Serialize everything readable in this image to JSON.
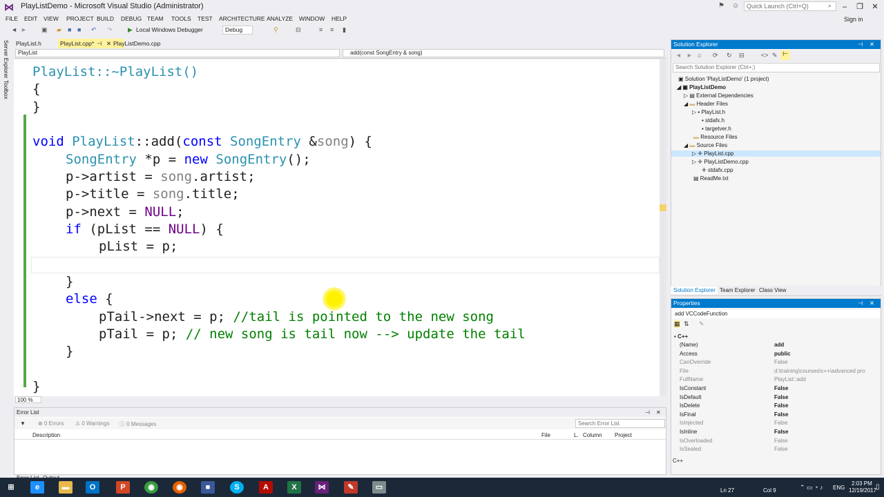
{
  "window": {
    "title": "PlayListDemo - Microsoft Visual Studio (Administrator)",
    "quick_launch_placeholder": "Quick Launch (Ctrl+Q)",
    "signin": "Sign in"
  },
  "menu": [
    "FILE",
    "EDIT",
    "VIEW",
    "PROJECT",
    "BUILD",
    "DEBUG",
    "TEAM",
    "TOOLS",
    "TEST",
    "ARCHITECTURE",
    "ANALYZE",
    "WINDOW",
    "HELP"
  ],
  "toolbar": {
    "debugger": "Local Windows Debugger",
    "configuration": "Debug"
  },
  "side_strip": [
    "Server Explorer",
    "Toolbox"
  ],
  "doc_tabs": [
    "PlayList.h",
    "PlayList.cpp*",
    "PlayListDemo.cpp"
  ],
  "navbar": {
    "scope": "PlayList",
    "member": "add(const SongEntry & song)"
  },
  "code": {
    "l1": "PlayList::~PlayList()",
    "l2": "{",
    "l3": "}",
    "l5_kw": "void",
    "l5_cls": "PlayList",
    "l5_a": "::add(",
    "l5_const": "const",
    "l5_type": "SongEntry",
    "l5_b": " &",
    "l5_param": "song",
    "l5_c": ") {",
    "l6_type": "SongEntry",
    "l6_a": " *p = ",
    "l6_new": "new",
    "l6_type2": "SongEntry",
    "l6_b": "();",
    "l7_a": "p->artist = ",
    "l7_g": "song",
    "l7_b": ".artist;",
    "l8_a": "p->title = ",
    "l8_g": "song",
    "l8_b": ".title;",
    "l9_a": "p->next = ",
    "l9_m": "NULL",
    "l9_b": ";",
    "l10_kw": "if",
    "l10_a": " (pList == ",
    "l10_m": "NULL",
    "l10_b": ") {",
    "l11": "pList = p;",
    "l13": "}",
    "l14_kw": "else",
    "l14_b": " {",
    "l15_a": "pTail->next = p; ",
    "l15_c": "//tail is pointed to the new song",
    "l16_a": "pTail = p; ",
    "l16_c": "// new song is tail now --> update the tail",
    "l17": "}",
    "l19": "}"
  },
  "editor_zoom": "100 %",
  "error_list": {
    "title": "Error List",
    "errors": "0 Errors",
    "warnings": "0 Warnings",
    "messages": "0 Messages",
    "search_placeholder": "Search Error List",
    "columns": [
      "Description",
      "File",
      "L.",
      "Column",
      "Project"
    ]
  },
  "bottom_tabs": [
    "Error List",
    "Output"
  ],
  "solution_explorer": {
    "title": "Solution Explorer",
    "search_placeholder": "Search Solution Explorer (Ctrl+;)",
    "tree": [
      "Solution 'PlayListDemo' (1 project)",
      "PlayListDemo",
      "External Dependencies",
      "Header Files",
      "PlayList.h",
      "stdafx.h",
      "targetver.h",
      "Resource Files",
      "Source Files",
      "PlayList.cpp",
      "PlayListDemo.cpp",
      "stdafx.cpp",
      "ReadMe.txt"
    ],
    "tabs": [
      "Solution Explorer",
      "Team Explorer",
      "Class View"
    ]
  },
  "properties": {
    "title": "Properties",
    "object": "add  VCCodeFunction",
    "category": "C++",
    "rows": [
      {
        "name": "(Name)",
        "value": "add"
      },
      {
        "name": "Access",
        "value": "public"
      },
      {
        "name": "CanOverride",
        "value": "False"
      },
      {
        "name": "File",
        "value": "d:\\training\\courses\\c++\\advanced pro"
      },
      {
        "name": "FullName",
        "value": "PlayList::add"
      },
      {
        "name": "IsConstant",
        "value": "False"
      },
      {
        "name": "IsDefault",
        "value": "False"
      },
      {
        "name": "IsDelete",
        "value": "False"
      },
      {
        "name": "IsFinal",
        "value": "False"
      },
      {
        "name": "IsInjected",
        "value": "False"
      },
      {
        "name": "IsInline",
        "value": "False"
      },
      {
        "name": "IsOverloaded",
        "value": "False"
      },
      {
        "name": "IsSealed",
        "value": "False"
      }
    ],
    "description": "C++"
  },
  "status": {
    "ln": "Ln 27",
    "col": "Col 9"
  },
  "taskbar": {
    "time": "2:03 PM",
    "date": "12/19/2017",
    "lang": "ENG"
  }
}
